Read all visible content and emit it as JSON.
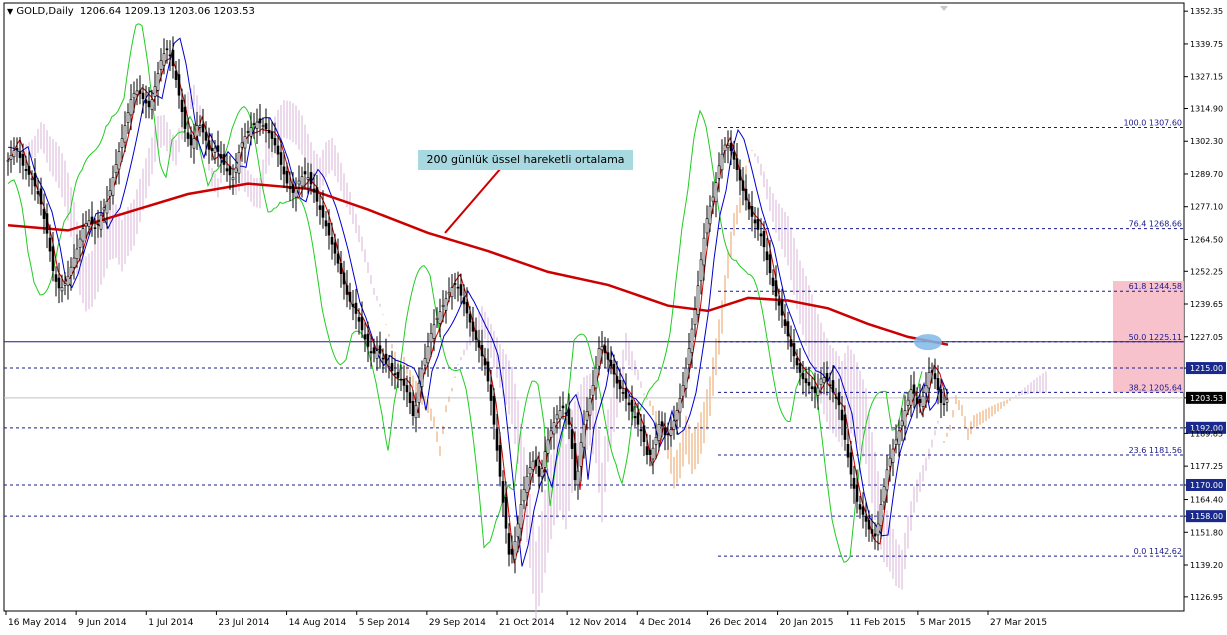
{
  "header": {
    "arrow": "▼",
    "symbol": "GOLD,Daily",
    "ohlc": "1206.64 1209.13 1203.06 1203.53"
  },
  "annotation": {
    "text": "200 günlük üssel hareketli ortalama"
  },
  "colors": {
    "background": "#ffffff",
    "axis": "#000000",
    "candle": "#000000",
    "ema200": "#cc0000",
    "tenkan": "#cc0000",
    "kijun": "#0000cc",
    "chikou": "#22cc22",
    "cloud_bull": "#d8b4d8",
    "cloud_bear": "#e8a060",
    "level_line": "#1a1a8c",
    "fib_zone": "#f7b7c4",
    "highlight_ellipse": "#7fb8e8",
    "annotation_box": "#a8d8e0"
  },
  "chart_data": {
    "type": "candlestick",
    "title": "GOLD,Daily",
    "ylim": [
      1121.5,
      1355.5
    ],
    "y_ticks": [
      1352.35,
      1339.75,
      1327.15,
      1314.9,
      1302.3,
      1289.7,
      1277.1,
      1264.5,
      1252.25,
      1239.65,
      1227.05,
      1215.0,
      1203.53,
      1192.0,
      1189.85,
      1177.25,
      1170.0,
      1164.4,
      1158.0,
      1151.8,
      1139.2,
      1126.95
    ],
    "x_ticks": [
      "16 May 2014",
      "9 Jun 2014",
      "1 Jul 2014",
      "23 Jul 2014",
      "14 Aug 2014",
      "5 Sep 2014",
      "29 Sep 2014",
      "21 Oct 2014",
      "12 Nov 2014",
      "4 Dec 2014",
      "26 Dec 2014",
      "20 Jan 2015",
      "11 Feb 2015",
      "5 Mar 2015",
      "27 Mar 2015"
    ],
    "horizontal_levels": [
      {
        "value": 1215.0,
        "label": "1215.00"
      },
      {
        "value": 1192.0,
        "label": "1192.00"
      },
      {
        "value": 1170.0,
        "label": "1170.00"
      },
      {
        "value": 1158.0,
        "label": "1158.00"
      }
    ],
    "current_price": 1203.53,
    "fibonacci": [
      {
        "level": "100.0",
        "value": 1307.6
      },
      {
        "level": "76.4",
        "value": 1268.66
      },
      {
        "level": "61.8",
        "value": 1244.58
      },
      {
        "level": "50.0",
        "value": 1225.11
      },
      {
        "level": "38.2",
        "value": 1205.64
      },
      {
        "level": "23.6",
        "value": 1181.56
      },
      {
        "level": "0.0",
        "value": 1142.62
      }
    ],
    "close_path": [
      [
        0,
        1295
      ],
      [
        8,
        1300
      ],
      [
        16,
        1292
      ],
      [
        24,
        1288
      ],
      [
        32,
        1280
      ],
      [
        40,
        1265
      ],
      [
        46,
        1250
      ],
      [
        52,
        1245
      ],
      [
        58,
        1248
      ],
      [
        64,
        1255
      ],
      [
        70,
        1262
      ],
      [
        76,
        1270
      ],
      [
        82,
        1272
      ],
      [
        88,
        1268
      ],
      [
        94,
        1275
      ],
      [
        100,
        1280
      ],
      [
        106,
        1290
      ],
      [
        112,
        1300
      ],
      [
        118,
        1310
      ],
      [
        124,
        1320
      ],
      [
        130,
        1322
      ],
      [
        136,
        1318
      ],
      [
        142,
        1315
      ],
      [
        148,
        1325
      ],
      [
        154,
        1335
      ],
      [
        160,
        1338
      ],
      [
        166,
        1330
      ],
      [
        172,
        1318
      ],
      [
        178,
        1305
      ],
      [
        184,
        1300
      ],
      [
        190,
        1310
      ],
      [
        196,
        1305
      ],
      [
        202,
        1298
      ],
      [
        208,
        1300
      ],
      [
        214,
        1295
      ],
      [
        220,
        1290
      ],
      [
        226,
        1288
      ],
      [
        232,
        1300
      ],
      [
        238,
        1305
      ],
      [
        244,
        1308
      ],
      [
        250,
        1310
      ],
      [
        256,
        1308
      ],
      [
        262,
        1305
      ],
      [
        268,
        1300
      ],
      [
        274,
        1292
      ],
      [
        280,
        1285
      ],
      [
        286,
        1282
      ],
      [
        292,
        1288
      ],
      [
        298,
        1290
      ],
      [
        304,
        1285
      ],
      [
        310,
        1278
      ],
      [
        316,
        1272
      ],
      [
        322,
        1265
      ],
      [
        328,
        1258
      ],
      [
        334,
        1250
      ],
      [
        340,
        1242
      ],
      [
        346,
        1238
      ],
      [
        352,
        1232
      ],
      [
        358,
        1225
      ],
      [
        364,
        1220
      ],
      [
        370,
        1222
      ],
      [
        376,
        1218
      ],
      [
        382,
        1215
      ],
      [
        388,
        1212
      ],
      [
        394,
        1210
      ],
      [
        400,
        1205
      ],
      [
        406,
        1195
      ],
      [
        412,
        1212
      ],
      [
        418,
        1220
      ],
      [
        424,
        1230
      ],
      [
        430,
        1235
      ],
      [
        436,
        1240
      ],
      [
        442,
        1245
      ],
      [
        448,
        1248
      ],
      [
        454,
        1242
      ],
      [
        460,
        1235
      ],
      [
        466,
        1228
      ],
      [
        472,
        1222
      ],
      [
        478,
        1215
      ],
      [
        484,
        1200
      ],
      [
        490,
        1180
      ],
      [
        496,
        1160
      ],
      [
        502,
        1140
      ],
      [
        508,
        1150
      ],
      [
        514,
        1165
      ],
      [
        520,
        1175
      ],
      [
        526,
        1180
      ],
      [
        532,
        1172
      ],
      [
        538,
        1185
      ],
      [
        544,
        1192
      ],
      [
        550,
        1198
      ],
      [
        556,
        1200
      ],
      [
        562,
        1192
      ],
      [
        568,
        1168
      ],
      [
        574,
        1190
      ],
      [
        580,
        1200
      ],
      [
        586,
        1210
      ],
      [
        592,
        1225
      ],
      [
        598,
        1220
      ],
      [
        604,
        1215
      ],
      [
        610,
        1208
      ],
      [
        616,
        1205
      ],
      [
        622,
        1200
      ],
      [
        628,
        1195
      ],
      [
        634,
        1190
      ],
      [
        640,
        1180
      ],
      [
        646,
        1185
      ],
      [
        652,
        1195
      ],
      [
        658,
        1188
      ],
      [
        664,
        1192
      ],
      [
        670,
        1200
      ],
      [
        676,
        1210
      ],
      [
        682,
        1225
      ],
      [
        688,
        1240
      ],
      [
        694,
        1260
      ],
      [
        700,
        1275
      ],
      [
        706,
        1282
      ],
      [
        712,
        1295
      ],
      [
        718,
        1302
      ],
      [
        724,
        1298
      ],
      [
        730,
        1290
      ],
      [
        736,
        1282
      ],
      [
        742,
        1275
      ],
      [
        748,
        1270
      ],
      [
        754,
        1265
      ],
      [
        760,
        1255
      ],
      [
        766,
        1245
      ],
      [
        772,
        1238
      ],
      [
        778,
        1230
      ],
      [
        784,
        1222
      ],
      [
        790,
        1215
      ],
      [
        796,
        1210
      ],
      [
        802,
        1208
      ],
      [
        808,
        1205
      ],
      [
        814,
        1212
      ],
      [
        820,
        1210
      ],
      [
        826,
        1205
      ],
      [
        832,
        1200
      ],
      [
        838,
        1185
      ],
      [
        844,
        1172
      ],
      [
        850,
        1162
      ],
      [
        856,
        1158
      ],
      [
        862,
        1152
      ],
      [
        868,
        1150
      ],
      [
        874,
        1165
      ],
      [
        880,
        1178
      ],
      [
        886,
        1185
      ],
      [
        892,
        1192
      ],
      [
        898,
        1200
      ],
      [
        904,
        1208
      ],
      [
        910,
        1200
      ],
      [
        916,
        1205
      ],
      [
        922,
        1215
      ],
      [
        928,
        1210
      ],
      [
        934,
        1200
      ],
      [
        940,
        1203.53
      ]
    ],
    "series": [
      {
        "name": "EMA 200",
        "color": "#cc0000",
        "points": [
          [
            0,
            1270
          ],
          [
            60,
            1268
          ],
          [
            120,
            1275
          ],
          [
            180,
            1282
          ],
          [
            240,
            1286
          ],
          [
            300,
            1284
          ],
          [
            360,
            1276
          ],
          [
            420,
            1267
          ],
          [
            480,
            1260
          ],
          [
            540,
            1252
          ],
          [
            600,
            1247
          ],
          [
            660,
            1239
          ],
          [
            700,
            1237
          ],
          [
            740,
            1242
          ],
          [
            780,
            1241
          ],
          [
            820,
            1238
          ],
          [
            860,
            1232
          ],
          [
            900,
            1227
          ],
          [
            940,
            1224
          ]
        ]
      }
    ]
  }
}
